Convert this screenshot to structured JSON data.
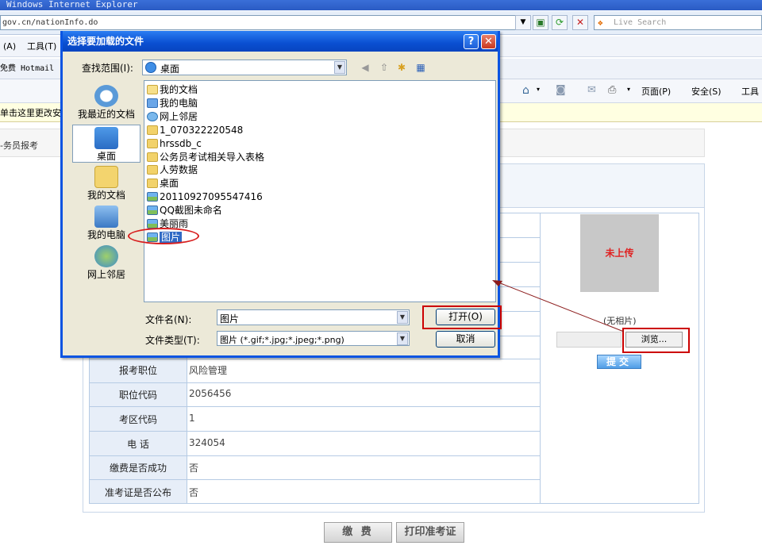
{
  "browser": {
    "title": "Windows Internet Explorer",
    "url": "gov.cn/nationInfo.do",
    "search_placeholder": "Live Search",
    "menu": [
      {
        "label": "(A)"
      },
      {
        "label": "工具(T)"
      }
    ],
    "favorites_item": "免费 Hotmail",
    "info_bar": "单击这里更改安",
    "command_bar": {
      "page": "页面(P)",
      "safety": "安全(S)",
      "tools": "工具"
    }
  },
  "page": {
    "breadcrumb": "-务员报考",
    "rows": [
      {
        "label": "报考职位",
        "value": "风险管理"
      },
      {
        "label": "职位代码",
        "value": "2056456"
      },
      {
        "label": "考区代码",
        "value": "1"
      },
      {
        "label": "电  话",
        "value": "324054"
      },
      {
        "label": "缴费是否成功",
        "value": "否"
      },
      {
        "label": "准考证是否公布",
        "value": "否"
      }
    ],
    "photo": {
      "placeholder_text": "未上传",
      "no_photo_text": "(无相片)",
      "browse_label": "浏览...",
      "submit_label": "提交"
    },
    "buttons": {
      "pay": "缴 费",
      "print_admission": "打印准考证"
    }
  },
  "dialog": {
    "title": "选择要加载的文件",
    "look_in_label": "查找范围(I):",
    "look_in_value": "桌面",
    "places": [
      {
        "label": "我最近的文档",
        "icon": "recent-documents-icon"
      },
      {
        "label": "桌面",
        "icon": "desktop-icon"
      },
      {
        "label": "我的文档",
        "icon": "my-documents-icon"
      },
      {
        "label": "我的电脑",
        "icon": "my-computer-icon"
      },
      {
        "label": "网上邻居",
        "icon": "network-places-icon"
      }
    ],
    "files": [
      {
        "name": "我的文档",
        "icon": "docs"
      },
      {
        "name": "我的电脑",
        "icon": "pc"
      },
      {
        "name": "网上邻居",
        "icon": "net"
      },
      {
        "name": "1_070322220548",
        "icon": "folder"
      },
      {
        "name": "hrssdb_c",
        "icon": "folder"
      },
      {
        "name": "公务员考试相关导入表格",
        "icon": "folder"
      },
      {
        "name": "人劳数据",
        "icon": "folder"
      },
      {
        "name": "桌面",
        "icon": "folder"
      },
      {
        "name": "20110927095547416",
        "icon": "img"
      },
      {
        "name": "QQ截图未命名",
        "icon": "img"
      },
      {
        "name": "美丽雨",
        "icon": "img"
      },
      {
        "name": "图片",
        "icon": "img",
        "selected": true
      }
    ],
    "file_name_label": "文件名(N):",
    "file_name_value": "图片",
    "file_type_label": "文件类型(T):",
    "file_type_value": "图片 (*.gif;*.jpg;*.jpeg;*.png)",
    "open_label": "打开(O)",
    "cancel_label": "取消"
  },
  "colors": {
    "highlight": "#cc0000",
    "selection": "#316ac5",
    "dialog_title": "#0a54e2"
  }
}
